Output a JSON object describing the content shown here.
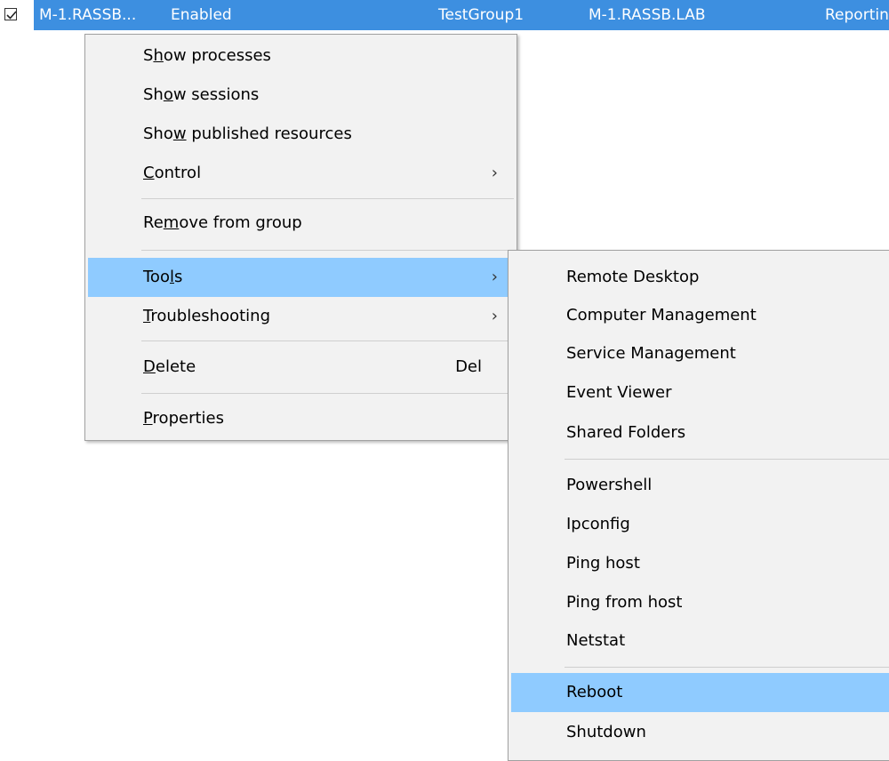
{
  "row": {
    "name": "M-1.RASSB...",
    "status": "Enabled",
    "group": "TestGroup1",
    "host": "M-1.RASSB.LAB",
    "state": "Reporting"
  },
  "colors": {
    "row_selection": "#3d8fe0",
    "menu_bg": "#f2f2f2",
    "highlight": "#8fcbff"
  },
  "context_menu": {
    "show_processes": {
      "pre": "S",
      "u": "h",
      "post": "ow processes"
    },
    "show_sessions": {
      "pre": "Sh",
      "u": "o",
      "post": "w sessions"
    },
    "show_published": {
      "pre": "Sho",
      "u": "w",
      "post": " published resources"
    },
    "control": {
      "pre": "",
      "u": "C",
      "post": "ontrol",
      "arrow": "›"
    },
    "remove_from_group": {
      "pre": "Re",
      "u": "m",
      "post": "ove from group"
    },
    "tools": {
      "pre": "Too",
      "u": "l",
      "post": "s",
      "arrow": "›"
    },
    "troubleshooting": {
      "pre": "",
      "u": "T",
      "post": "roubleshooting",
      "arrow": "›"
    },
    "delete": {
      "pre": "",
      "u": "D",
      "post": "elete",
      "shortcut": "Del"
    },
    "properties": {
      "pre": "",
      "u": "P",
      "post": "roperties"
    }
  },
  "tools_menu": {
    "items": [
      "Remote Desktop",
      "Computer Management",
      "Service Management",
      "Event Viewer",
      "Shared Folders",
      "Powershell",
      "Ipconfig",
      "Ping host",
      "Ping from host",
      "Netstat",
      "Reboot",
      "Shutdown"
    ]
  }
}
